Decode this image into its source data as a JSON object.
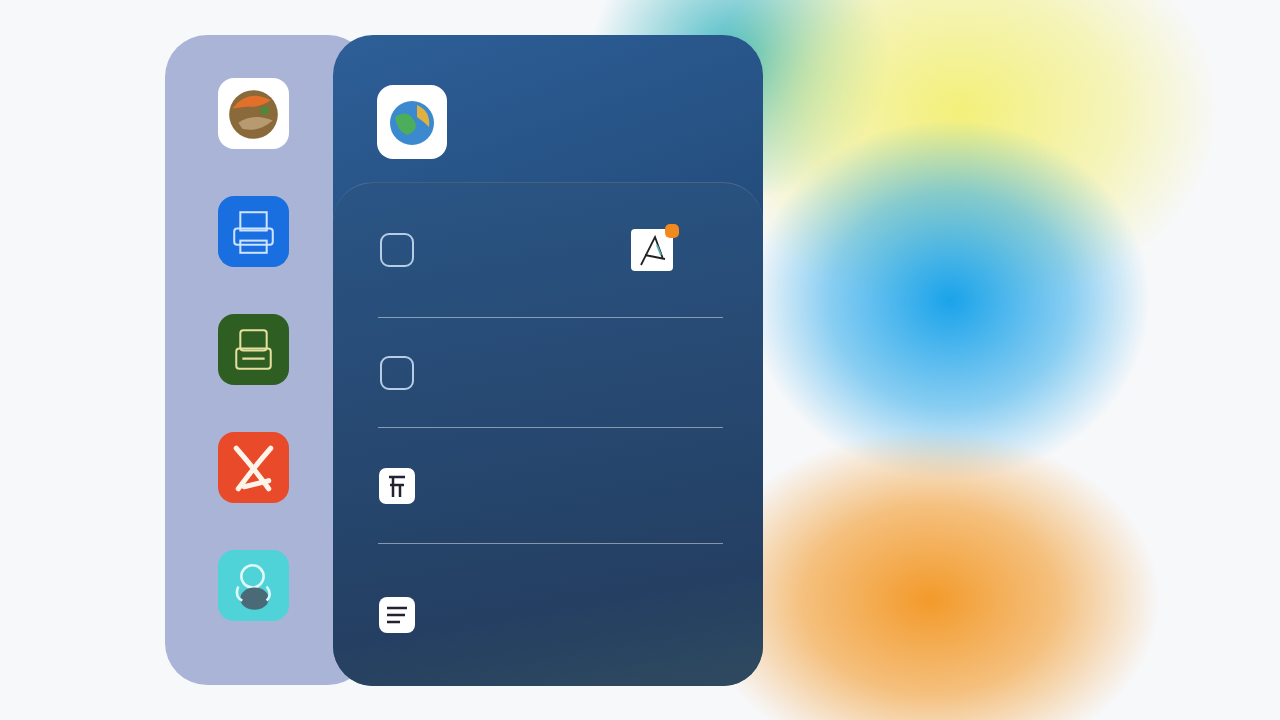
{
  "sidebar": {
    "apps": [
      {
        "kind": "photo"
      },
      {
        "kind": "printer"
      },
      {
        "kind": "archive"
      },
      {
        "kind": "scissors"
      },
      {
        "kind": "figure"
      }
    ]
  },
  "panel": {
    "header_app": {
      "kind": "globe"
    },
    "rows": [
      {
        "kind": "square",
        "app": {
          "kind": "pen",
          "badge": true
        }
      },
      {
        "kind": "square"
      },
      {
        "kind": "document"
      },
      {
        "kind": "list"
      }
    ]
  }
}
